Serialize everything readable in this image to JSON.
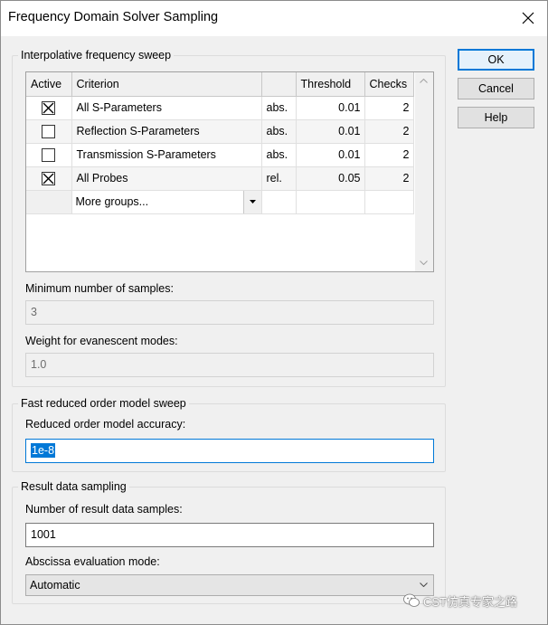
{
  "window": {
    "title": "Frequency Domain Solver Sampling",
    "close_icon": "close-icon"
  },
  "buttons": {
    "ok": "OK",
    "cancel": "Cancel",
    "help": "Help"
  },
  "interpolative": {
    "group_title": "Interpolative frequency sweep",
    "columns": [
      "Active",
      "Criterion",
      "",
      "Threshold",
      "Checks"
    ],
    "rows": [
      {
        "active": true,
        "criterion": "All S-Parameters",
        "mode": "abs.",
        "threshold": "0.01",
        "checks": "2"
      },
      {
        "active": false,
        "criterion": "Reflection S-Parameters",
        "mode": "abs.",
        "threshold": "0.01",
        "checks": "2"
      },
      {
        "active": false,
        "criterion": "Transmission S-Parameters",
        "mode": "abs.",
        "threshold": "0.01",
        "checks": "2"
      },
      {
        "active": true,
        "criterion": "All Probes",
        "mode": "rel.",
        "threshold": "0.05",
        "checks": "2"
      }
    ],
    "more_groups": "More groups...",
    "min_samples_label": "Minimum number of samples:",
    "min_samples_value": "3",
    "weight_label": "Weight for evanescent modes:",
    "weight_value": "1.0"
  },
  "fast_rom": {
    "group_title": "Fast reduced order model sweep",
    "accuracy_label": "Reduced order model accuracy:",
    "accuracy_value": "1e-8"
  },
  "result_sampling": {
    "group_title": "Result data sampling",
    "samples_label": "Number of result data samples:",
    "samples_value": "1001",
    "abscissa_label": "Abscissa evaluation mode:",
    "abscissa_value": "Automatic"
  },
  "watermark": {
    "text": "CST仿真专家之路"
  }
}
